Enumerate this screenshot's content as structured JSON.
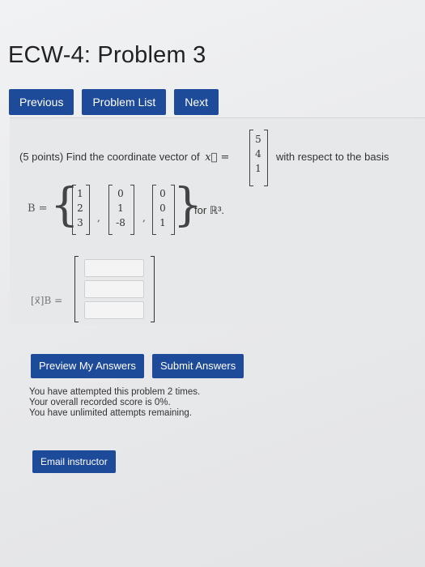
{
  "page": {
    "title": "ECW-4: Problem 3"
  },
  "nav": {
    "previous": "Previous",
    "problem_list": "Problem List",
    "next": "Next"
  },
  "problem": {
    "intro": "(5 points) Find the coordinate vector of",
    "x_symbol": "x⃗ =",
    "x_vector": [
      "5",
      "4",
      "1"
    ],
    "after": "with respect to the basis",
    "basis_label": "B =",
    "basis_vectors": [
      [
        "1",
        "2",
        "3"
      ],
      [
        "0",
        "1",
        "-8"
      ],
      [
        "0",
        "0",
        "1"
      ]
    ],
    "for_text": "for ℝ³.",
    "answer_label": "[x⃗]B ="
  },
  "buttons": {
    "preview": "Preview My Answers",
    "submit": "Submit Answers",
    "email": "Email instructor"
  },
  "status": {
    "attempts": "You have attempted this problem 2 times.",
    "score": "Your overall recorded score is 0%.",
    "remaining": "You have unlimited attempts remaining."
  },
  "colors": {
    "button": "#1e4a9a",
    "panel": "#e7e8ea"
  }
}
